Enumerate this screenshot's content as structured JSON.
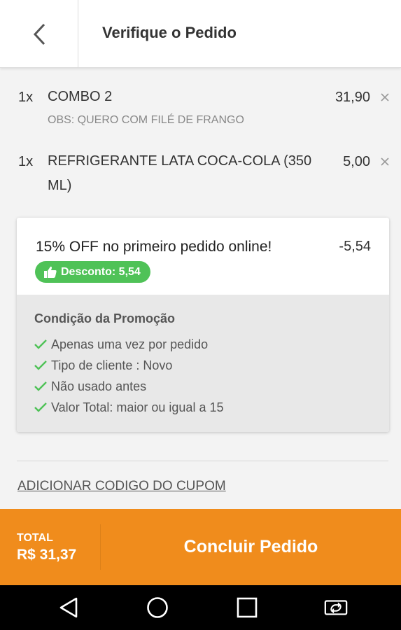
{
  "header": {
    "title": "Verifique o Pedido",
    "back_icon": "chevron-left-icon"
  },
  "items": [
    {
      "qty": "1x",
      "name": "COMBO 2",
      "price": "31,90",
      "obs": "OBS: QUERO COM FILÉ DE FRANGO",
      "remove_icon": "close-icon"
    },
    {
      "qty": "1x",
      "name": "REFRIGERANTE LATA COCA-COLA (350 ML)",
      "price": "5,00",
      "remove_icon": "close-icon"
    }
  ],
  "promo": {
    "title": "15% OFF no primeiro pedido online!",
    "amount": "-5,54",
    "badge": "Desconto: 5,54",
    "badge_icon": "thumbs-up-icon",
    "badge_color": "#4fc257",
    "condition_title": "Condição da Promoção",
    "conditions": [
      "Apenas uma vez por pedido",
      "Tipo de cliente : Novo",
      "Não usado antes",
      "Valor Total: maior ou igual a 15"
    ],
    "check_color": "#4fc257"
  },
  "coupon": {
    "link_label": "ADICIONAR CODIGO DO CUPOM"
  },
  "footer": {
    "total_label": "TOTAL",
    "total_value": "R$ 31,37",
    "confirm_label": "Concluir Pedido",
    "accent_color": "#f08c1c"
  },
  "system_nav": {
    "icons": [
      "back-triangle-icon",
      "home-circle-icon",
      "recents-square-icon",
      "screen-rotate-icon"
    ]
  }
}
